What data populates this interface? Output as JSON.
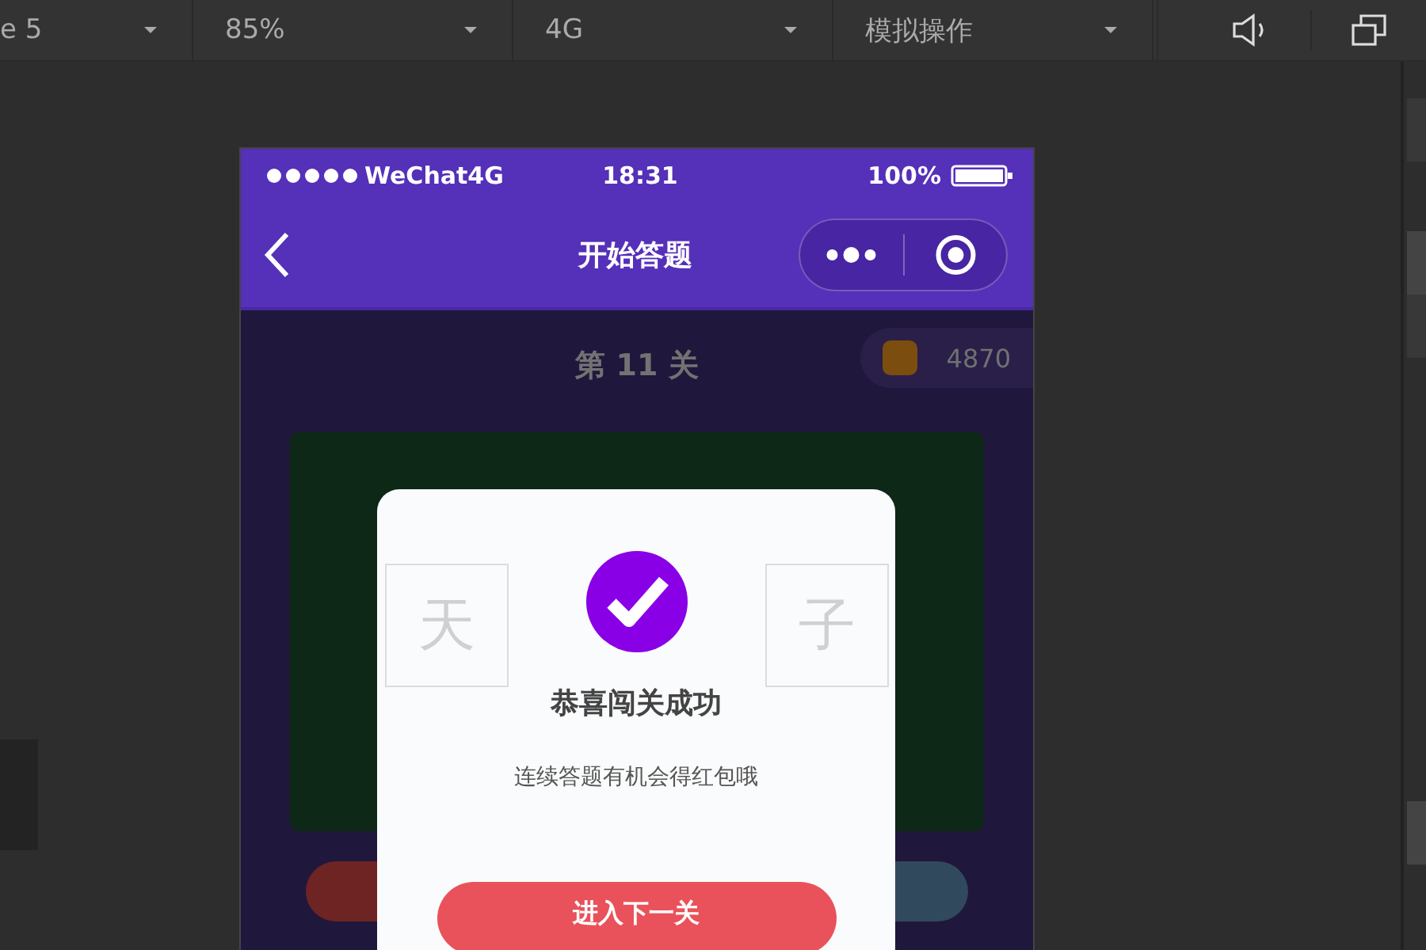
{
  "toolbar": {
    "dropdowns": [
      {
        "label": "e 5"
      },
      {
        "label": "85%"
      },
      {
        "label": "4G"
      },
      {
        "label": "模拟操作"
      }
    ]
  },
  "phone": {
    "status_bar": {
      "carrier": "WeChat4G",
      "time": "18:31",
      "battery": "100%"
    },
    "nav": {
      "title": "开始答题"
    },
    "level": "第 11 关",
    "coins": "4870",
    "cells": [
      {
        "char": "天",
        "covered": false
      },
      {
        "covered": true
      },
      {
        "covered": true
      },
      {
        "char": "子",
        "covered": false
      }
    ],
    "dialog": {
      "title": "恭喜闯关成功",
      "message": "连续答题有机会得红包哦",
      "button": "进入下一关"
    }
  }
}
